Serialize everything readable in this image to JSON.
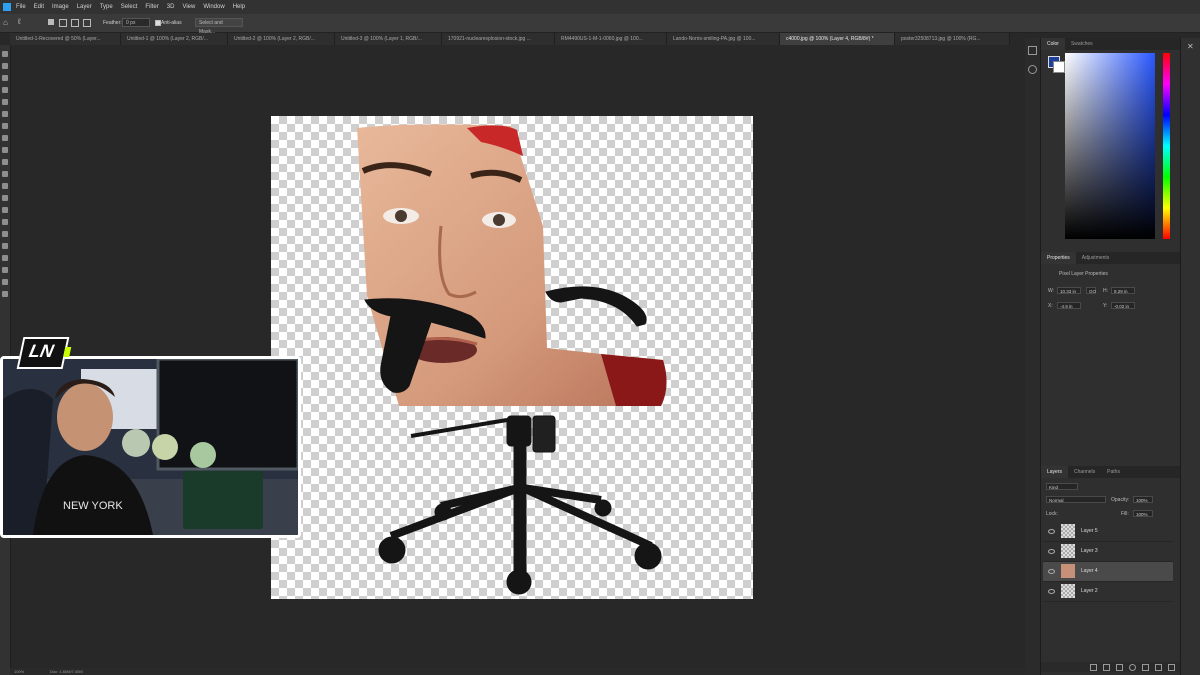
{
  "menu": [
    "File",
    "Edit",
    "Image",
    "Layer",
    "Type",
    "Select",
    "Filter",
    "3D",
    "View",
    "Window",
    "Help"
  ],
  "options": {
    "feather_label": "Feather:",
    "feather_value": "0 px",
    "antialias_label": "Anti-alias",
    "select_mask_button": "Select and Mask..."
  },
  "tabs": [
    {
      "label": "Untitled-1-Recovered @ 50% (Layer..."
    },
    {
      "label": "Untitled-1 @ 100% (Layer 2, RGB/..."
    },
    {
      "label": "Untitled-2 @ 100% (Layer 2, RGB/..."
    },
    {
      "label": "Untitled-3 @ 100% (Layer 1, RGB/..."
    },
    {
      "label": "170921-nuclearexplosion-stock.jpg ..."
    },
    {
      "label": "RM4490US-1-M-1-0060.jpg @ 100..."
    },
    {
      "label": "Lando-Norris-smiling-PA.jpg @ 100..."
    },
    {
      "label": "c4000.jpg @ 100% (Layer 4, RGB/8#) *"
    },
    {
      "label": "poster32508713.jpg @ 100% (RG..."
    }
  ],
  "color_panel": {
    "tabs": [
      "Color",
      "Swatches"
    ],
    "foreground": "#1f3f9f",
    "background": "#ffffff",
    "hue": "#2a58ff"
  },
  "properties": {
    "tabs": [
      "Properties",
      "Adjustments"
    ],
    "heading": "Pixel Layer Properties",
    "w_label": "W:",
    "w_value": "10.33 in",
    "h_label": "H:",
    "h_value": "9.29 in",
    "x_label": "X:",
    "x_value": "-4.9 in",
    "y_label": "Y:",
    "y_value": "-0.02 in",
    "link_label": "GO"
  },
  "layers_panel": {
    "tabs": [
      "Layers",
      "Channels",
      "Paths"
    ],
    "filter": "Kind",
    "blend_mode": "Normal",
    "opacity_label": "Opacity:",
    "opacity_value": "100%",
    "lock_label": "Lock:",
    "fill_label": "Fill:",
    "fill_value": "100%",
    "layers": [
      {
        "name": "Layer 5"
      },
      {
        "name": "Layer 3"
      },
      {
        "name": "Layer 4"
      },
      {
        "name": "Layer 2"
      }
    ]
  },
  "status": {
    "zoom": "100%",
    "doc": "Doc: 1.80M/7.40M"
  },
  "webcam": {
    "logo": "LN",
    "shirt_text": "NEW YORK"
  }
}
